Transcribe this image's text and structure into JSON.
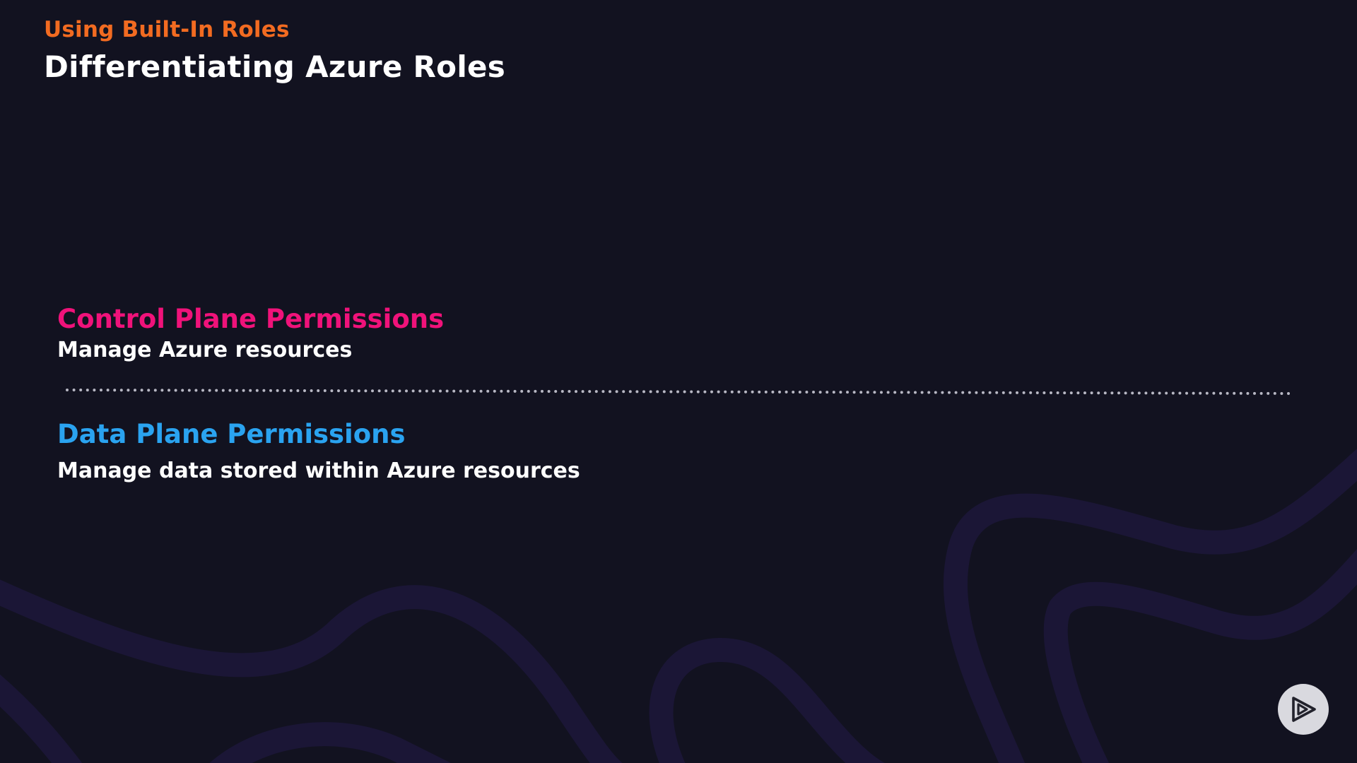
{
  "slide": {
    "section_label": "Using Built-In Roles",
    "title": "Differentiating Azure Roles"
  },
  "permissions": [
    {
      "heading": "Control Plane Permissions",
      "description": "Manage Azure resources"
    },
    {
      "heading": "Data Plane Permissions",
      "description": "Manage data stored within Azure resources"
    }
  ],
  "colors": {
    "background": "#121220",
    "section_label": "#f26b21",
    "title": "#ffffff",
    "control_heading": "#f0127a",
    "data_heading": "#2aa3f0",
    "description": "#ffffff",
    "divider_dots": "#b8b8c4",
    "wave": "#1b1636"
  },
  "icons": {
    "play_button": "play-logo-icon"
  }
}
